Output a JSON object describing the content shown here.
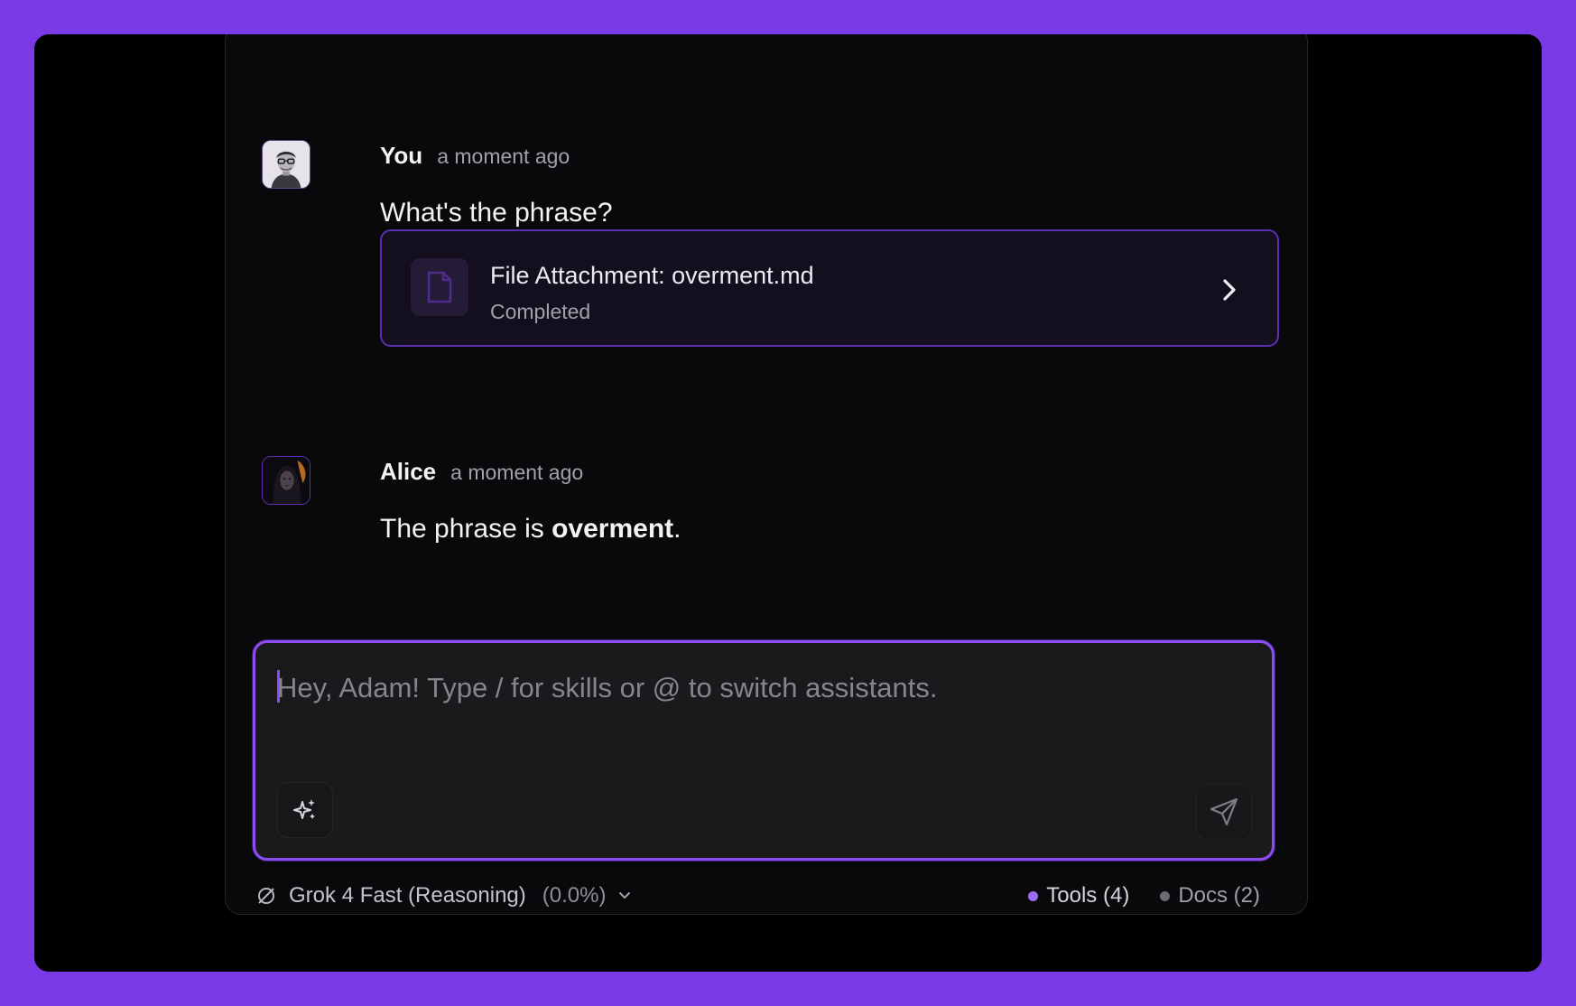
{
  "colors": {
    "page_background": "#7a3ae6",
    "window_background": "#000000",
    "panel_background": "#09090b",
    "accent": "#8b4cf0",
    "attachment_border": "#5b2fb0",
    "tools_dot": "#9b6cf5",
    "docs_dot": "#6b6b73"
  },
  "messages": [
    {
      "author": "You",
      "time": "a moment ago",
      "text": "What's the phrase?",
      "avatar_icon": "user-avatar-glasses-sketch",
      "attachment": {
        "icon": "document-icon",
        "title": "File Attachment: overment.md",
        "status": "Completed",
        "action_icon": "chevron-right-icon"
      }
    },
    {
      "author": "Alice",
      "time": "a moment ago",
      "avatar_icon": "assistant-avatar-portrait",
      "text_before": "The phrase is ",
      "text_bold": "overment",
      "text_after": "."
    }
  ],
  "composer": {
    "placeholder": "Hey, Adam! Type / for skills or @ to switch assistants.",
    "value": "",
    "skills_icon": "sparkles-icon",
    "send_icon": "send-icon"
  },
  "footer": {
    "model_icon": "refresh-icon",
    "model_name": "Grok 4 Fast (Reasoning)",
    "model_usage": "(0.0%)",
    "dropdown_icon": "chevron-down-icon",
    "tools_label": "Tools (4)",
    "docs_label": "Docs (2)"
  }
}
